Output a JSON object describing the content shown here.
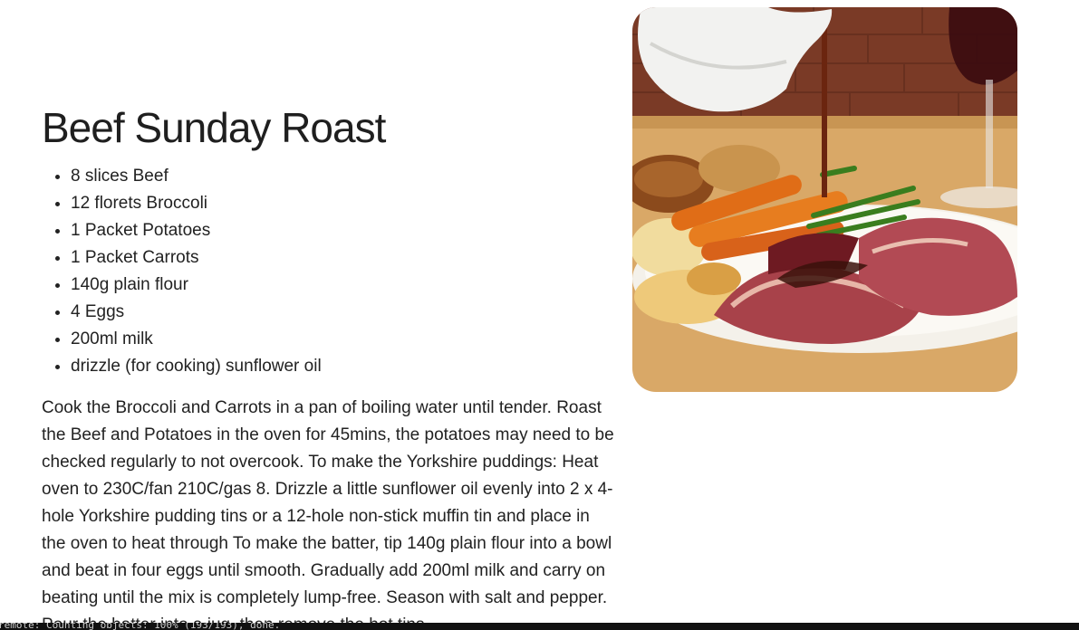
{
  "recipe": {
    "title": "Beef Sunday Roast",
    "ingredients": [
      "8 slices Beef",
      "12 florets Broccoli",
      "1 Packet Potatoes",
      "1 Packet Carrots",
      "140g plain flour",
      "4 Eggs",
      "200ml milk",
      "drizzle (for cooking) sunflower oil"
    ],
    "method": "Cook the Broccoli and Carrots in a pan of boiling water until tender. Roast the Beef and Potatoes in the oven for 45mins, the potatoes may need to be checked regularly to not overcook. To make the Yorkshire puddings: Heat oven to 230C/fan 210C/gas 8. Drizzle a little sunflower oil evenly into 2 x 4-hole Yorkshire pudding tins or a 12-hole non-stick muffin tin and place in the oven to heat through To make the batter, tip 140g plain flour into a bowl and beat in four eggs until smooth. Gradually add 200ml milk and carry on beating until the mix is completely lump-free. Season with salt and pepper. Pour the batter into a jug, then remove the hot tins"
  },
  "terminal": {
    "status_text": "remote: Counting objects: 100% (193/193), done."
  },
  "colors": {
    "accent_text": "#222222",
    "terminal_bg": "#111111"
  }
}
